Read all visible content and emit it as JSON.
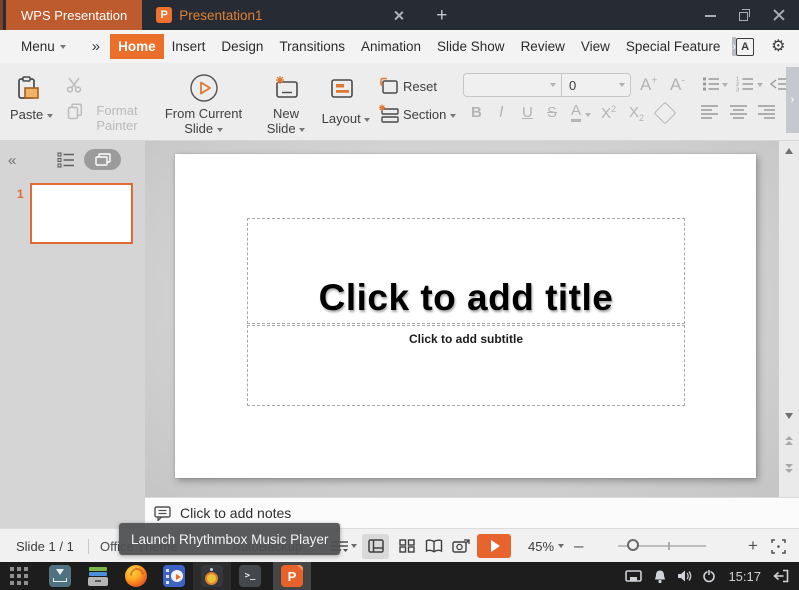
{
  "titlebar": {
    "app_button": "WPS Presentation",
    "tab_title": "Presentation1",
    "new_tab_glyph": "+"
  },
  "menubar": {
    "menu_label": "Menu",
    "overflow_glyph": "»",
    "tabs": [
      {
        "label": "Home",
        "active": true
      },
      {
        "label": "Insert"
      },
      {
        "label": "Design"
      },
      {
        "label": "Transitions"
      },
      {
        "label": "Animation"
      },
      {
        "label": "Slide Show"
      },
      {
        "label": "Review"
      },
      {
        "label": "View"
      },
      {
        "label": "Special Feature"
      }
    ],
    "tab_scroll_glyph": "›",
    "text_tool_glyph": "A"
  },
  "toolbar": {
    "paste": "Paste",
    "format_painter_line1": "Format",
    "format_painter_line2": "Painter",
    "from_current_line1": "From Current",
    "from_current_line2": "Slide",
    "new_slide_line1": "New",
    "new_slide_line2": "Slide",
    "layout": "Layout",
    "reset": "Reset",
    "section": "Section",
    "font_name_value": "",
    "font_size_value": "0",
    "format": {
      "bold": "B",
      "italic": "I",
      "underline": "U",
      "strikethrough": "S",
      "font_color": "A",
      "script_base": "X",
      "superscript_exp": "2",
      "subscript_sub": "2",
      "grow_letter": "A",
      "grow_sign": "+",
      "shrink_letter": "A",
      "shrink_sign": "-"
    },
    "expand_glyph": "›"
  },
  "slides_panel": {
    "slide_number": "1",
    "collapse_glyph": "«"
  },
  "slide": {
    "title_placeholder": "Click to add title",
    "subtitle_placeholder": "Click to add subtitle"
  },
  "notes_bar": {
    "placeholder": "Click to add notes"
  },
  "statusbar": {
    "slide_indicator": "Slide 1 / 1",
    "theme_name": "Office Theme",
    "autobackup": "AutoBackup",
    "zoom_percent": "45%",
    "zoom_out_glyph": "–",
    "zoom_in_glyph": "+"
  },
  "tooltip": {
    "text": "Launch Rhythmbox Music Player"
  },
  "taskbar": {
    "clock": "15:17"
  },
  "colors": {
    "accent_orange": "#ec6e2d",
    "app_button_orange": "#bd5a2e",
    "titlebar_bg": "#272b34",
    "taskbar_bg": "#1d1d1d",
    "selection_border": "#e06a35",
    "play_button": "#e7642e"
  }
}
